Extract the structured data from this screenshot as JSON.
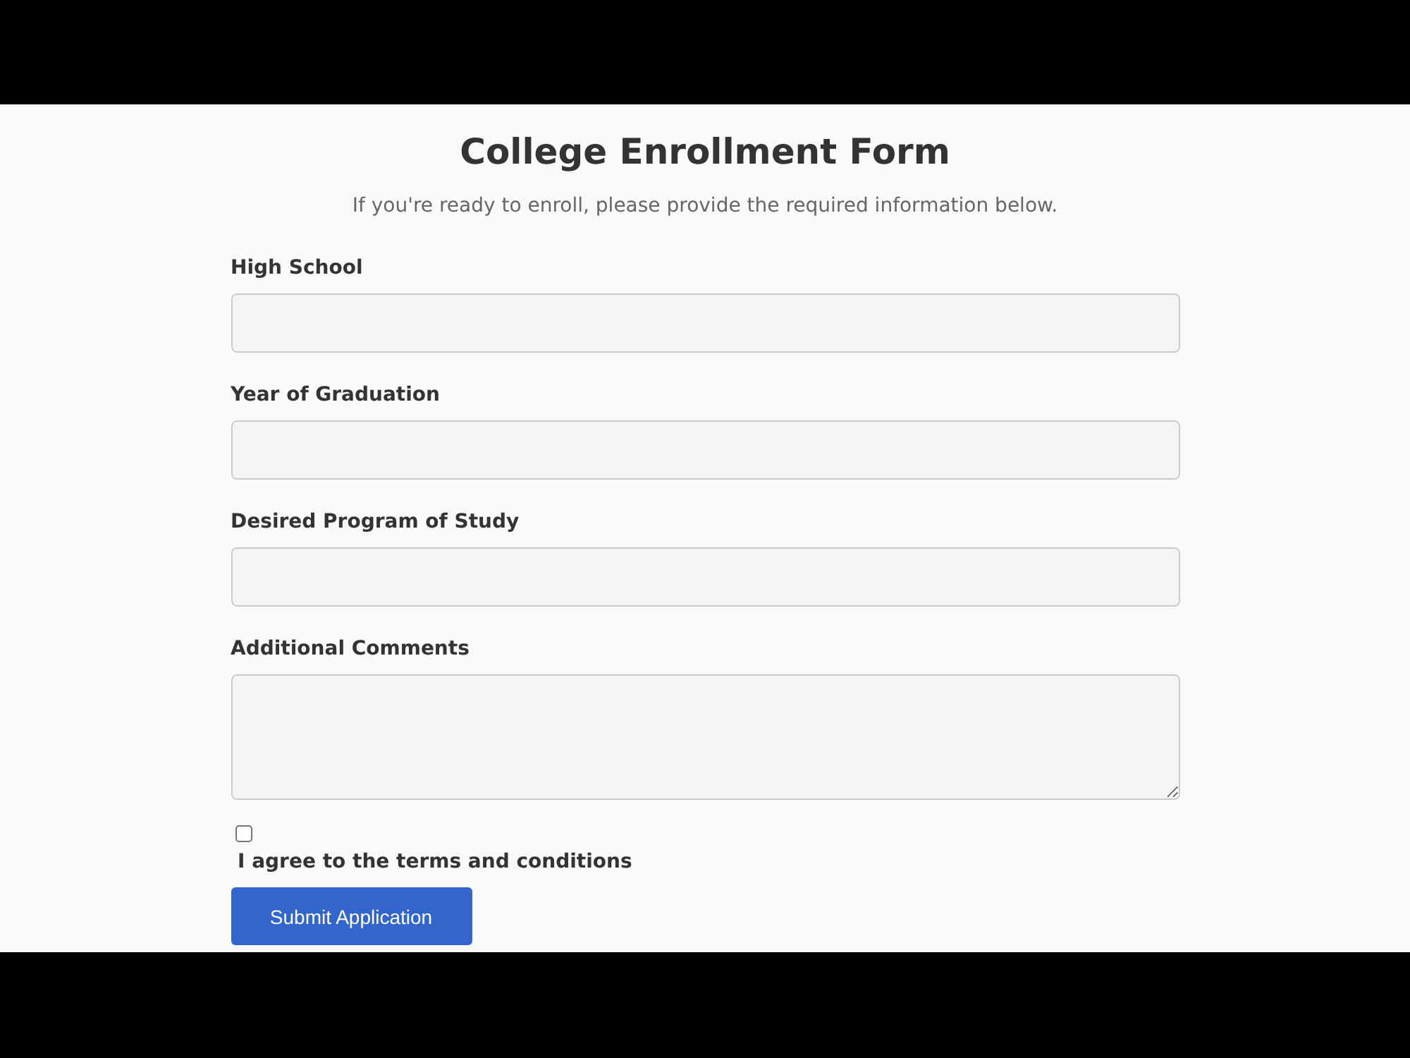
{
  "title": "College Enrollment Form",
  "subtitle": "If you're ready to enroll, please provide the required information below.",
  "fields": [
    {
      "label": "High School",
      "kind": "input"
    },
    {
      "label": "Year of Graduation",
      "kind": "input"
    },
    {
      "label": "Desired Program of Study",
      "kind": "input"
    },
    {
      "label": "Additional Comments",
      "kind": "textarea"
    }
  ],
  "agreement": {
    "label": "I agree to the terms and conditions",
    "checked": false
  },
  "submit_button": "Submit Application"
}
